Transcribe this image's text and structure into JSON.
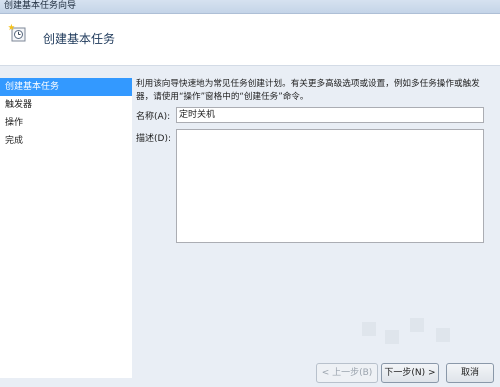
{
  "window": {
    "title": "创建基本任务向导"
  },
  "header": {
    "title": "创建基本任务",
    "icon": "task-wizard-icon"
  },
  "steps": [
    {
      "label": "创建基本任务",
      "active": true
    },
    {
      "label": "触发器",
      "active": false
    },
    {
      "label": "操作",
      "active": false
    },
    {
      "label": "完成",
      "active": false
    }
  ],
  "main": {
    "description_line1": "利用该向导快速地为常见任务创建计划。有关更多高级选项或设置，例如多任务操作或触发",
    "description_line2": "器，请使用“操作”窗格中的“创建任务”命令。",
    "name_label": "名称(A):",
    "name_value": "定时关机",
    "desc_label": "描述(D):",
    "desc_value": ""
  },
  "buttons": {
    "back": "< 上一步(B)",
    "next": "下一步(N) >",
    "cancel": "取消"
  },
  "colors": {
    "accent": "#3399ff",
    "background": "#e9eef5"
  }
}
